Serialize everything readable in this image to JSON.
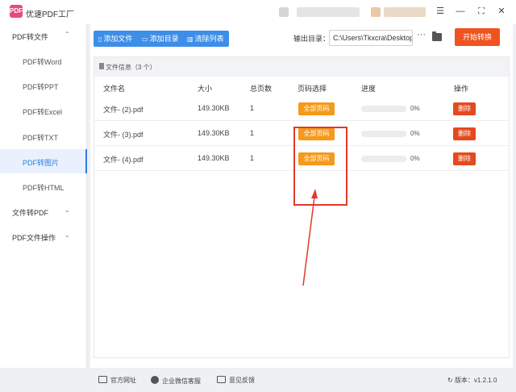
{
  "app": {
    "logo_text": "PDF",
    "title": "优速PDF工厂"
  },
  "window_controls": {
    "menu": "☰",
    "minimize": "—",
    "maximize": "⛶",
    "close": "✕"
  },
  "sidebar": {
    "groups": [
      {
        "label": "PDF转文件",
        "chevron": "⌃"
      },
      {
        "label": "文件转PDF",
        "chevron": "⌄"
      },
      {
        "label": "PDF文件操作",
        "chevron": "⌄"
      }
    ],
    "items": [
      {
        "label": "PDF转Word"
      },
      {
        "label": "PDF转PPT"
      },
      {
        "label": "PDF转Excel"
      },
      {
        "label": "PDF转TXT"
      },
      {
        "label": "PDF转图片"
      },
      {
        "label": "PDF转HTML"
      }
    ]
  },
  "toolbar": {
    "add_file": "添加文件",
    "add_dir": "添加目录",
    "clear_list": "清除列表",
    "output_label": "输出目录：",
    "output_path": "C:\\Users\\Tkxcra\\Desktop",
    "more": "···",
    "start": "开始转换"
  },
  "file_info": {
    "label": "文件信息（3 个）"
  },
  "table": {
    "headers": [
      "文件名",
      "大小",
      "总页数",
      "页码选择",
      "进度",
      "操作"
    ],
    "rows": [
      {
        "name": "文件- (2).pdf",
        "size": "149.30KB",
        "pages": "1",
        "page_select": "全部页码",
        "progress": 0,
        "progress_text": "0%",
        "action": "删除"
      },
      {
        "name": "文件- (3).pdf",
        "size": "149.30KB",
        "pages": "1",
        "page_select": "全部页码",
        "progress": 0,
        "progress_text": "0%",
        "action": "删除"
      },
      {
        "name": "文件- (4).pdf",
        "size": "149.30KB",
        "pages": "1",
        "page_select": "全部页码",
        "progress": 0,
        "progress_text": "0%",
        "action": "删除"
      }
    ]
  },
  "footer": {
    "website": "官方网址",
    "wechat": "企业微信客服",
    "feedback": "意见反馈",
    "version": "版本：v1.2.1.0"
  },
  "colors": {
    "accent": "#3d8ee8",
    "start_button": "#f0531f",
    "page_select_button": "#f59a1b",
    "delete_button": "#e34a1f",
    "annotation_red": "#e23a2a"
  }
}
